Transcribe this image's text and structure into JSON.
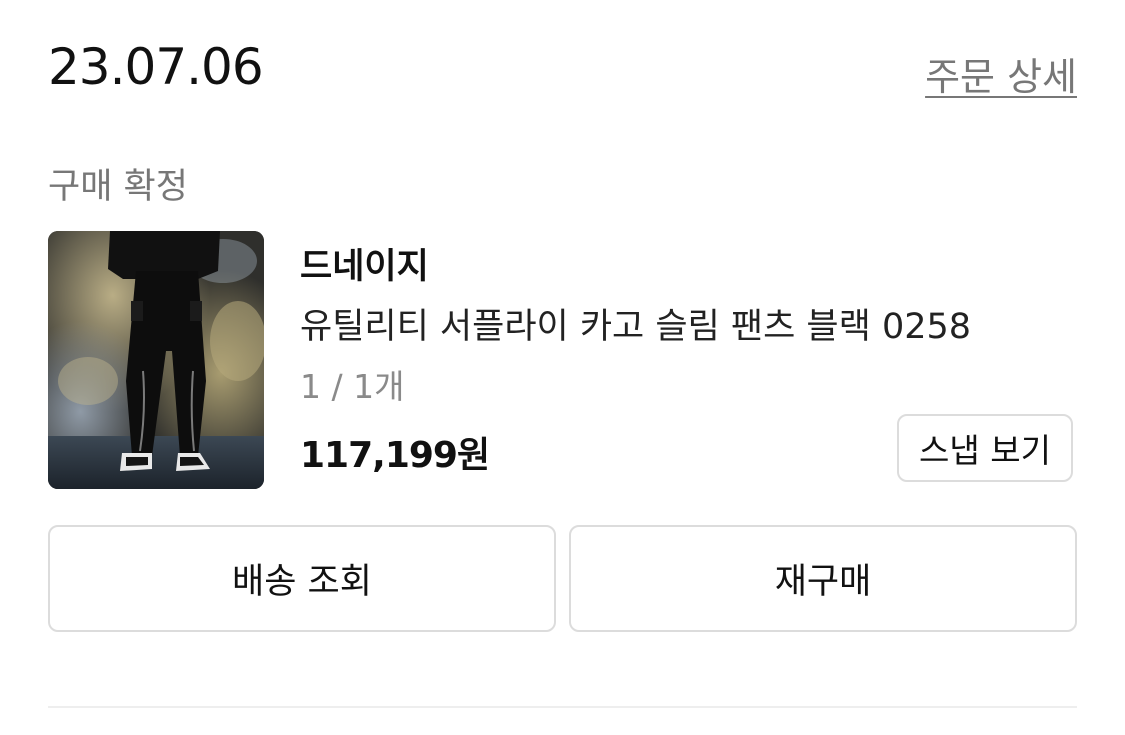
{
  "order": {
    "date": "23.07.06",
    "detail_link_label": "주문 상세",
    "status": "구매 확정"
  },
  "product": {
    "brand": "드네이지",
    "name": "유틸리티 서플라이 카고 슬림 팬츠 블랙 0258",
    "quantity": "1 / 1개",
    "price": "117,199원",
    "snap_button_label": "스냅 보기"
  },
  "actions": {
    "tracking_label": "배송 조회",
    "reorder_label": "재구매"
  },
  "colors": {
    "text_primary": "#111111",
    "text_secondary": "#777777",
    "border": "#dcdcdc",
    "divider": "#eeeeee"
  }
}
